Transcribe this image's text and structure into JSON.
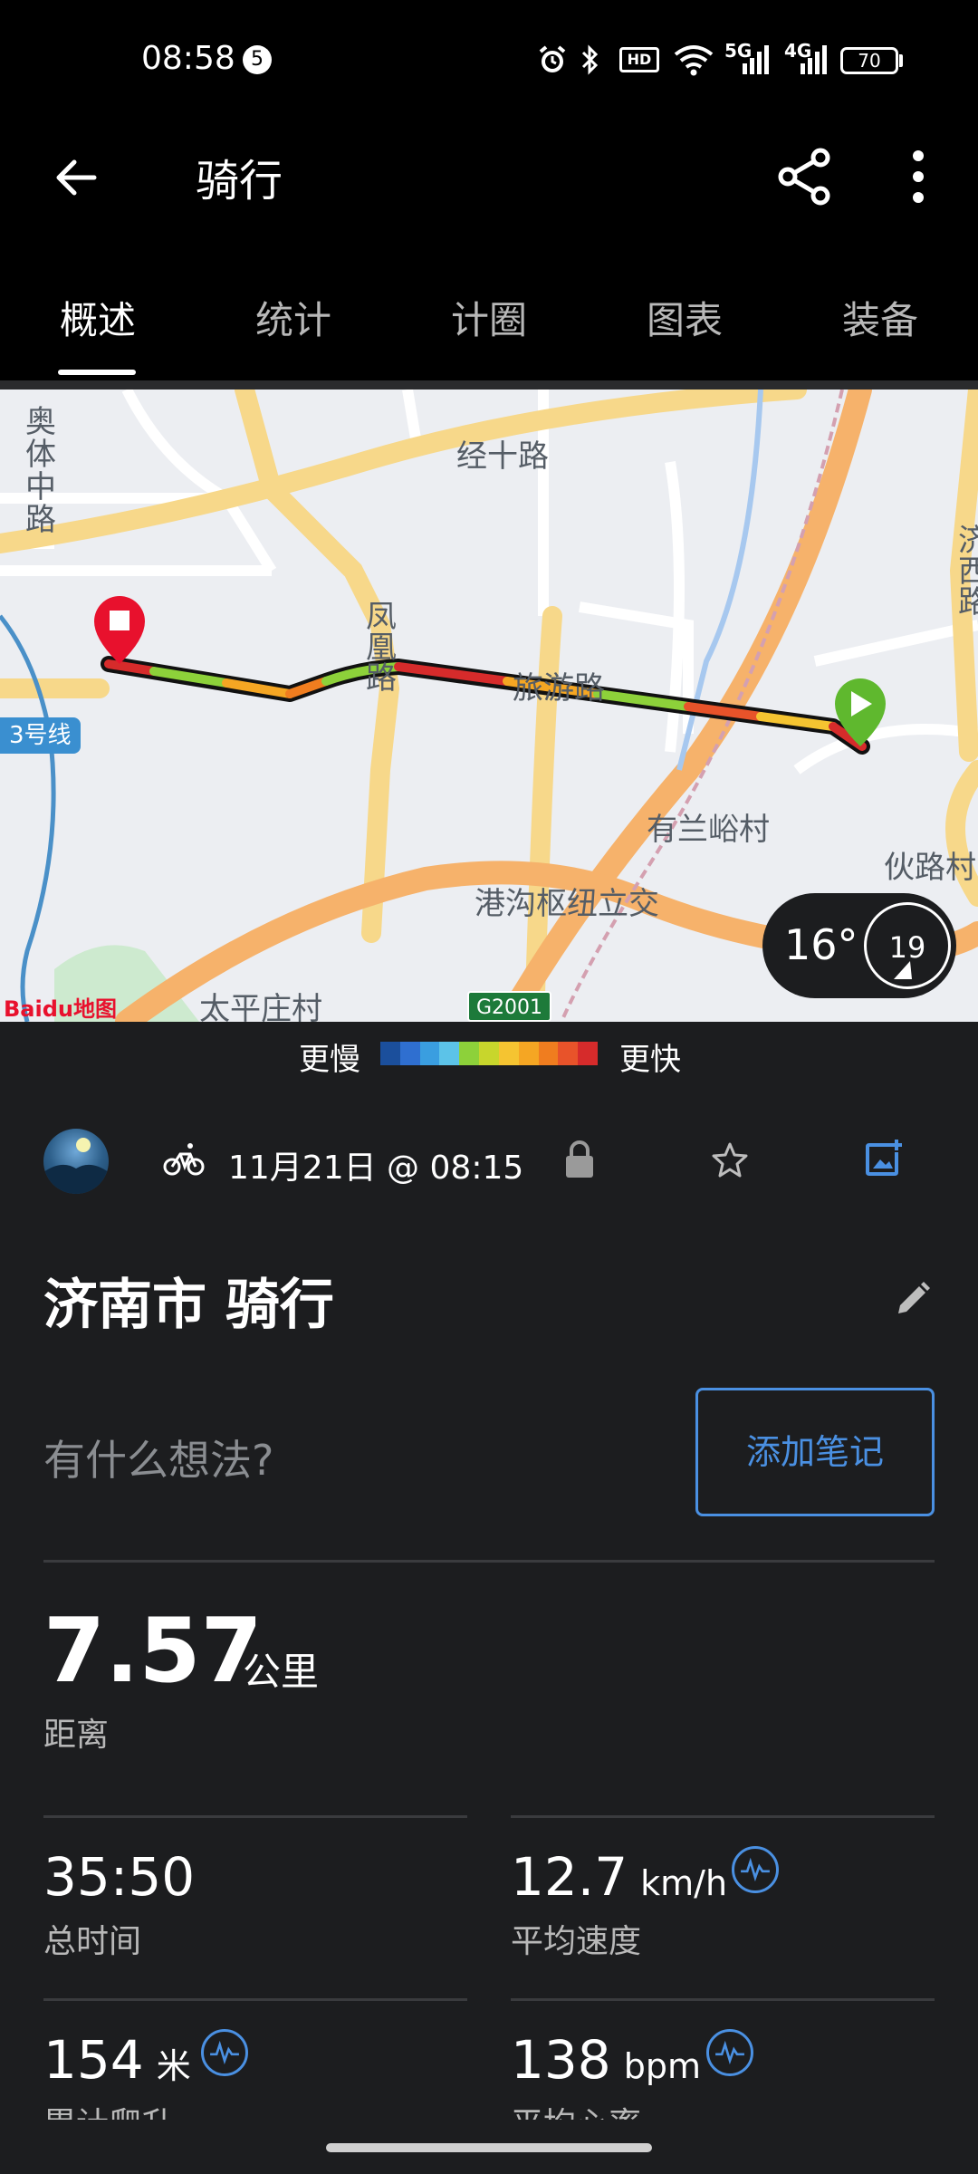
{
  "status_bar": {
    "time": "08:58",
    "notification_count": "5",
    "signal_5g": "5G",
    "signal_4g": "4G",
    "hd": "HD",
    "battery": "70"
  },
  "app_bar": {
    "title": "骑行"
  },
  "tabs": [
    {
      "label": "概述",
      "active": true
    },
    {
      "label": "统计",
      "active": false
    },
    {
      "label": "计圈",
      "active": false
    },
    {
      "label": "图表",
      "active": false
    },
    {
      "label": "装备",
      "active": false
    }
  ],
  "map": {
    "labels": {
      "aoti": "奥体中路",
      "jingshi": "经十路",
      "fenghuang": "凤凰路",
      "lvyou": "旅游路",
      "youlanyu": "有兰峪村",
      "ganggou": "港沟枢纽立交",
      "taiping": "太平庄村",
      "huolu": "伙路村",
      "jingxi": "济西路",
      "line3": "3号线",
      "g2001": "G2001",
      "baidu": "Baidu地图"
    },
    "weather": {
      "temperature": "16°",
      "wind": "19"
    }
  },
  "legend": {
    "slower": "更慢",
    "faster": "更快",
    "colors": [
      "#1b4f9c",
      "#2f6fd0",
      "#3a9ee0",
      "#5cc3e8",
      "#8dd13a",
      "#c8d62c",
      "#f5c431",
      "#f5a623",
      "#f07d1f",
      "#e8532a",
      "#d62b2b"
    ]
  },
  "activity": {
    "date": "11月21日 @ 08:15",
    "title": "济南市 骑行",
    "note_prompt": "有什么想法?",
    "add_note": "添加笔记"
  },
  "stats": {
    "distance": {
      "value": "7.57",
      "unit": "公里",
      "label": "距离"
    },
    "total_time": {
      "value": "35:50",
      "label": "总时间"
    },
    "avg_speed": {
      "value": "12.7",
      "unit": "km/h",
      "label": "平均速度"
    },
    "elevation": {
      "value": "154",
      "unit": "米",
      "label": "累计爬升"
    },
    "avg_hr": {
      "value": "138",
      "unit": "bpm",
      "label": "平均心率"
    }
  },
  "colors": {
    "accent": "#4a90e2",
    "start": "#5fb82e",
    "end": "#e8112d"
  }
}
